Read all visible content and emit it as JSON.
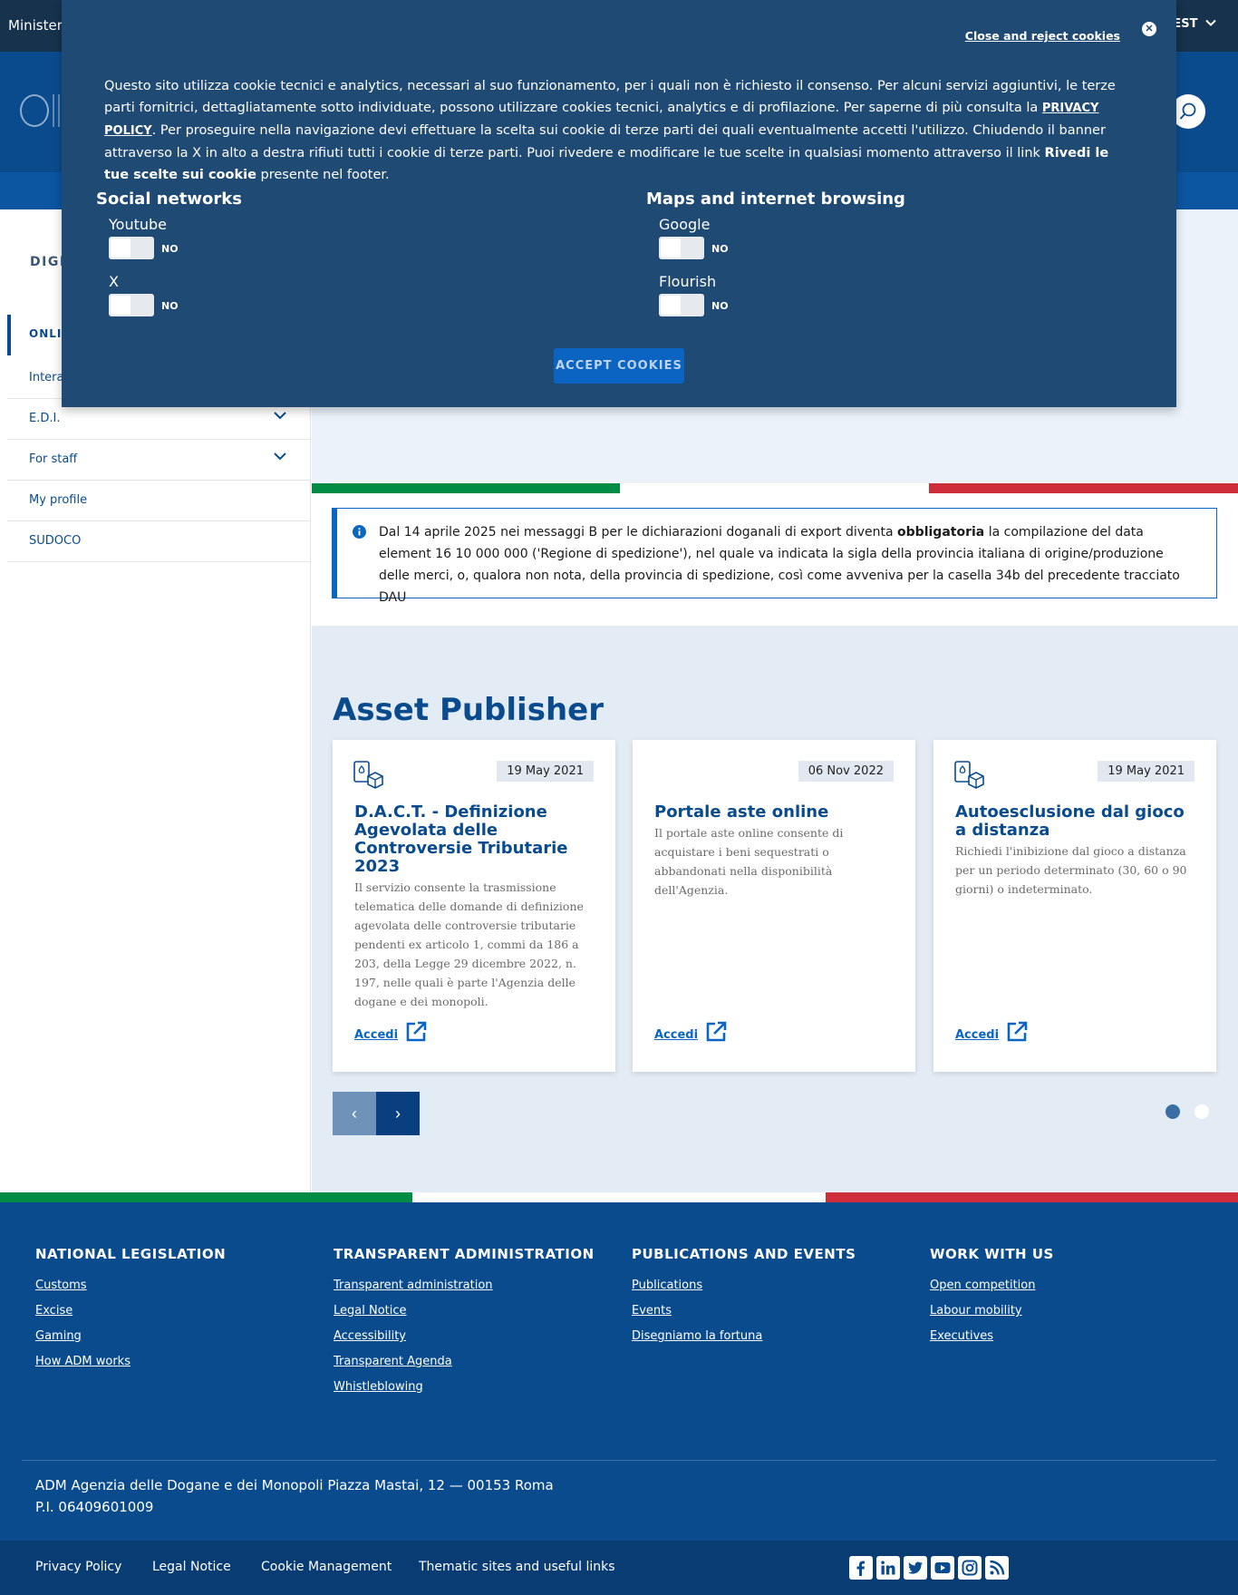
{
  "header": {
    "ministry": "Ministero",
    "lang": "EST"
  },
  "sidebar": {
    "section_title": "DIGIT",
    "active_item": "ONLI",
    "items": [
      {
        "label": "Intera"
      },
      {
        "label": "E.D.I.",
        "expandable": true
      },
      {
        "label": "For staff",
        "expandable": true
      },
      {
        "label": "My profile"
      },
      {
        "label": "SUDOCO"
      }
    ]
  },
  "notice": {
    "before": "Dal 14 aprile 2025 nei messaggi B per le dichiarazioni doganali di export diventa ",
    "bold": "obbligatoria",
    "after": " la compilazione del data element 16 10 000 000 ('Regione di spedizione'), nel quale va indicata la sigla della provincia italiana di origine/produzione delle merci, o, qualora non nota, della provincia di spedizione, così come avveniva per la casella 34b del precedente tracciato DAU"
  },
  "asset_publisher": {
    "title": "Asset Publisher",
    "cards": [
      {
        "date": "19 May 2021",
        "title": "D.A.C.T. - Definizione Agevolata delle Controversie Tributarie 2023",
        "description": "Il servizio consente la trasmissione telematica delle domande di definizione agevolata delle controversie tributarie pendenti ex articolo 1, commi da 186 a 203, della Legge 29 dicembre 2022, n. 197, nelle quali è parte l'Agenzia delle dogane e dei monopoli.",
        "link": "Accedi",
        "icon": "gaming-cards-dice-icon"
      },
      {
        "date": "06 Nov 2022",
        "title": "Portale aste online",
        "description": "Il portale aste online consente di acquistare i beni sequestrati o abbandonati nella disponibilità dell'Agenzia.",
        "link": "Accedi",
        "icon": ""
      },
      {
        "date": "19 May 2021",
        "title": "Autoesclusione dal gioco a distanza",
        "description": "Richiedi l'inibizione dal gioco a distanza per un periodo determinato (30, 60 o 90 giorni) o indeterminato.",
        "link": "Accedi",
        "icon": "gaming-cards-dice-icon"
      }
    ],
    "prev_label": "‹",
    "next_label": "›",
    "pages": 2,
    "current_page": 1
  },
  "footer": {
    "columns": [
      {
        "heading": "NATIONAL LEGISLATION",
        "links": [
          "Customs",
          "Excise",
          "Gaming",
          "How ADM works"
        ]
      },
      {
        "heading": "TRANSPARENT ADMINISTRATION",
        "links": [
          "Transparent administration",
          "Legal Notice",
          "Accessibility",
          "Transparent Agenda",
          "Whistleblowing"
        ]
      },
      {
        "heading": "PUBLICATIONS AND EVENTS",
        "links": [
          "Publications",
          "Events",
          "Disegniamo la fortuna"
        ]
      },
      {
        "heading": "WORK WITH US",
        "links": [
          "Open competition",
          "Labour mobility",
          "Executives"
        ]
      }
    ],
    "address_line1": "ADM Agenzia delle Dogane e dei Monopoli Piazza Mastai, 12 — 00153 Roma",
    "address_line2": "P.I. 06409601009",
    "bottom_links": [
      "Privacy Policy",
      "Legal Notice",
      "Cookie Management",
      "Thematic sites and useful links"
    ],
    "social": [
      "facebook-icon",
      "linkedin-icon",
      "twitter-icon",
      "youtube-icon",
      "instagram-icon",
      "rss-icon"
    ]
  },
  "cookie_banner": {
    "close_link": "Close and reject cookies",
    "text_1": "Questo sito utilizza cookie tecnici e analytics, necessari al suo funzionamento, per i quali non è richiesto il consenso. Per alcuni servizi aggiuntivi, le terze parti fornitrici, dettagliatamente sotto individuate, possono utilizzare cookies tecnici, analytics e di profilazione. Per saperne di più consulta la ",
    "privacy_link": "PRIVACY POLICY",
    "text_2": ". Per proseguire nella navigazione devi effettuare la scelta sui cookie di terze parti dei quali eventualmente accetti l'utilizzo. Chiudendo il banner attraverso la X in alto a destra rifiuti tutti i cookie di terze parti. Puoi rivedere e modificare le tue scelte in qualsiasi momento attraverso il link ",
    "review_bold": "Rivedi le tue scelte sui cookie",
    "text_3": " presente nel footer.",
    "groups": [
      {
        "title": "Social networks",
        "items": [
          {
            "name": "Youtube",
            "state": "NO"
          },
          {
            "name": "X",
            "state": "NO"
          }
        ]
      },
      {
        "title": "Maps and internet browsing",
        "items": [
          {
            "name": "Google",
            "state": "NO"
          },
          {
            "name": "Flourish",
            "state": "NO"
          }
        ]
      }
    ],
    "accept_label": "ACCEPT COOKIES"
  },
  "colors": {
    "primary": "#0a4b8e",
    "cookie_bg": "#1f4a74",
    "flag_green": "#008c45",
    "flag_white": "#ffffff",
    "flag_red": "#cd2e3a"
  }
}
